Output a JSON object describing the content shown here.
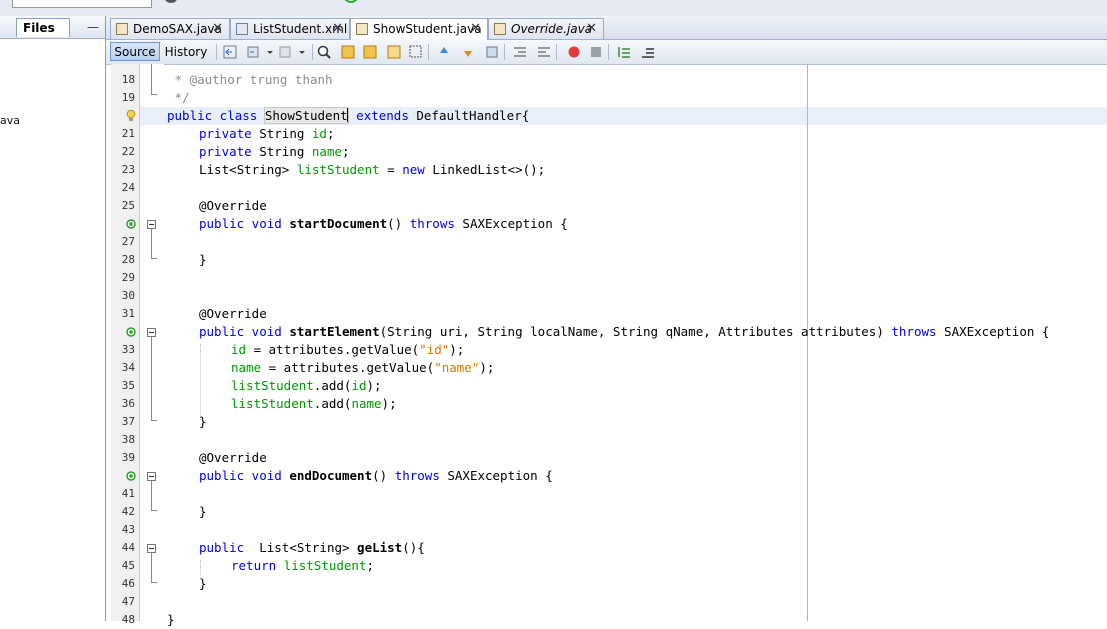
{
  "files_panel": {
    "title": "Files",
    "minimize": "—",
    "partial_item": "ava"
  },
  "tabs": [
    {
      "label": "DemoSAX.java",
      "close": "✕"
    },
    {
      "label": "ListStudent.xml",
      "close": "✕"
    },
    {
      "label": "ShowStudent.java",
      "close": "✕"
    },
    {
      "label": "Override.java",
      "close": "✕"
    }
  ],
  "toolbar": {
    "source": "Source",
    "history": "History"
  },
  "lines": [
    {
      "n": "18",
      "parts": [
        [
          " * ",
          "cm"
        ],
        [
          "@author trung thanh",
          "cm"
        ]
      ]
    },
    {
      "n": "19",
      "parts": [
        [
          " */",
          "cm"
        ]
      ]
    },
    {
      "n": "",
      "parts": []
    },
    {
      "n": "21",
      "parts": []
    },
    {
      "n": "22",
      "parts": []
    },
    {
      "n": "23",
      "parts": []
    },
    {
      "n": "24",
      "parts": []
    },
    {
      "n": "25",
      "parts": []
    },
    {
      "n": "",
      "parts": []
    },
    {
      "n": "27",
      "parts": []
    },
    {
      "n": "28",
      "parts": []
    },
    {
      "n": "29",
      "parts": []
    },
    {
      "n": "30",
      "parts": []
    },
    {
      "n": "31",
      "parts": []
    },
    {
      "n": "",
      "parts": []
    },
    {
      "n": "33",
      "parts": []
    },
    {
      "n": "34",
      "parts": []
    },
    {
      "n": "35",
      "parts": []
    },
    {
      "n": "36",
      "parts": []
    },
    {
      "n": "37",
      "parts": []
    },
    {
      "n": "38",
      "parts": []
    },
    {
      "n": "39",
      "parts": []
    },
    {
      "n": "",
      "parts": []
    },
    {
      "n": "41",
      "parts": []
    },
    {
      "n": "42",
      "parts": []
    },
    {
      "n": "43",
      "parts": []
    },
    {
      "n": "44",
      "parts": []
    },
    {
      "n": "45",
      "parts": []
    },
    {
      "n": "46",
      "parts": []
    },
    {
      "n": "47",
      "parts": []
    },
    {
      "n": "48",
      "parts": []
    }
  ],
  "code": {
    "l18_a": " * ",
    "l18_b": "@author trung thanh",
    "l19": " */",
    "l20_kw": "public class ",
    "l20_cls": "ShowStudent",
    "l20_ext": " extends ",
    "l20_rest": "DefaultHandler{",
    "l21_kw": "private ",
    "l21_type": "String ",
    "l21_f": "id",
    "l21_end": ";",
    "l22_kw": "private ",
    "l22_type": "String ",
    "l22_f": "name",
    "l22_end": ";",
    "l23_a": "List<String> ",
    "l23_f": "listStudent",
    "l23_b": " = ",
    "l23_kw": "new",
    "l23_c": " LinkedList<>();",
    "l25": "@Override",
    "l26_kw": "public void ",
    "l26_m": "startDocument",
    "l26_a": "() ",
    "l26_th": "throws",
    "l26_b": " SAXException {",
    "l28": "}",
    "l31": "@Override",
    "l32_kw": "public void ",
    "l32_m": "startElement",
    "l32_a": "(String uri, String localName, String qName, Attributes attributes) ",
    "l32_th": "throws",
    "l32_b": " SAXException {",
    "l33_f": "id",
    "l33_a": " = attributes.getValue(",
    "l33_s": "\"id\"",
    "l33_b": ");",
    "l34_f": "name",
    "l34_a": " = attributes.getValue(",
    "l34_s": "\"name\"",
    "l34_b": ");",
    "l35_f": "listStudent",
    "l35_a": ".add(",
    "l35_f2": "id",
    "l35_b": ");",
    "l36_f": "listStudent",
    "l36_a": ".add(",
    "l36_f2": "name",
    "l36_b": ");",
    "l37": "}",
    "l39": "@Override",
    "l40_kw": "public void ",
    "l40_m": "endDocument",
    "l40_a": "() ",
    "l40_th": "throws",
    "l40_b": " SAXException {",
    "l42": "}",
    "l44_kw": "public ",
    "l44_a": " List<String> ",
    "l44_m": "geList",
    "l44_b": "(){",
    "l45_kw": "return ",
    "l45_f": "listStudent",
    "l45_b": ";",
    "l46": "}",
    "l48": "}"
  },
  "colors": {
    "keyword": "#0000e6",
    "field": "#009900",
    "string": "#ce7b00",
    "comment": "#8c8c8c"
  }
}
